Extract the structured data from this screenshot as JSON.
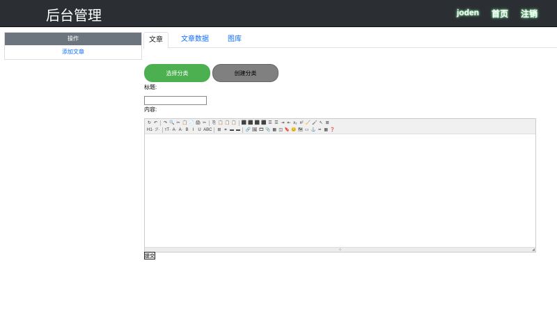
{
  "header": {
    "brand": "后台管理",
    "nav": {
      "user": "joden",
      "home": "首页",
      "logout": "注销"
    }
  },
  "sidebar": {
    "heading": "操作",
    "items": [
      {
        "label": "添加文章"
      }
    ]
  },
  "tabs": [
    {
      "label": "文章"
    },
    {
      "label": "文章数据"
    },
    {
      "label": "图库"
    }
  ],
  "form": {
    "choose_category": "选择分类",
    "create_category": "创建分类",
    "title_label": "标题:",
    "content_label": "内容:",
    "title_value": "",
    "submit_label": "提交"
  },
  "editor": {
    "row1": [
      "↻",
      "↶",
      "↷",
      "🔍",
      "✂",
      "📋",
      "📄",
      "🖨",
      "✂",
      "⎘",
      "📋",
      "📋",
      "📋",
      "⬛",
      "⬛",
      "⬛",
      "⬛",
      "☰",
      "☰",
      "⇥",
      "⇤",
      "x₂",
      "x²",
      "🧹",
      "🖌",
      "↖",
      "⊞"
    ],
    "row2": [
      "H1·",
      "ℱ·",
      "ᴛT·",
      "A·",
      "A·",
      "B",
      "I",
      "U",
      "ABC",
      "⊞",
      "⌗",
      "▬",
      "▬",
      "🔗",
      "🖼",
      "🎞",
      "📎",
      "▦",
      "◫",
      "🔖",
      "😊",
      "🗺",
      "▭",
      "⚓",
      "━",
      "▦",
      "❓"
    ],
    "resize_glyph": "⊹"
  }
}
